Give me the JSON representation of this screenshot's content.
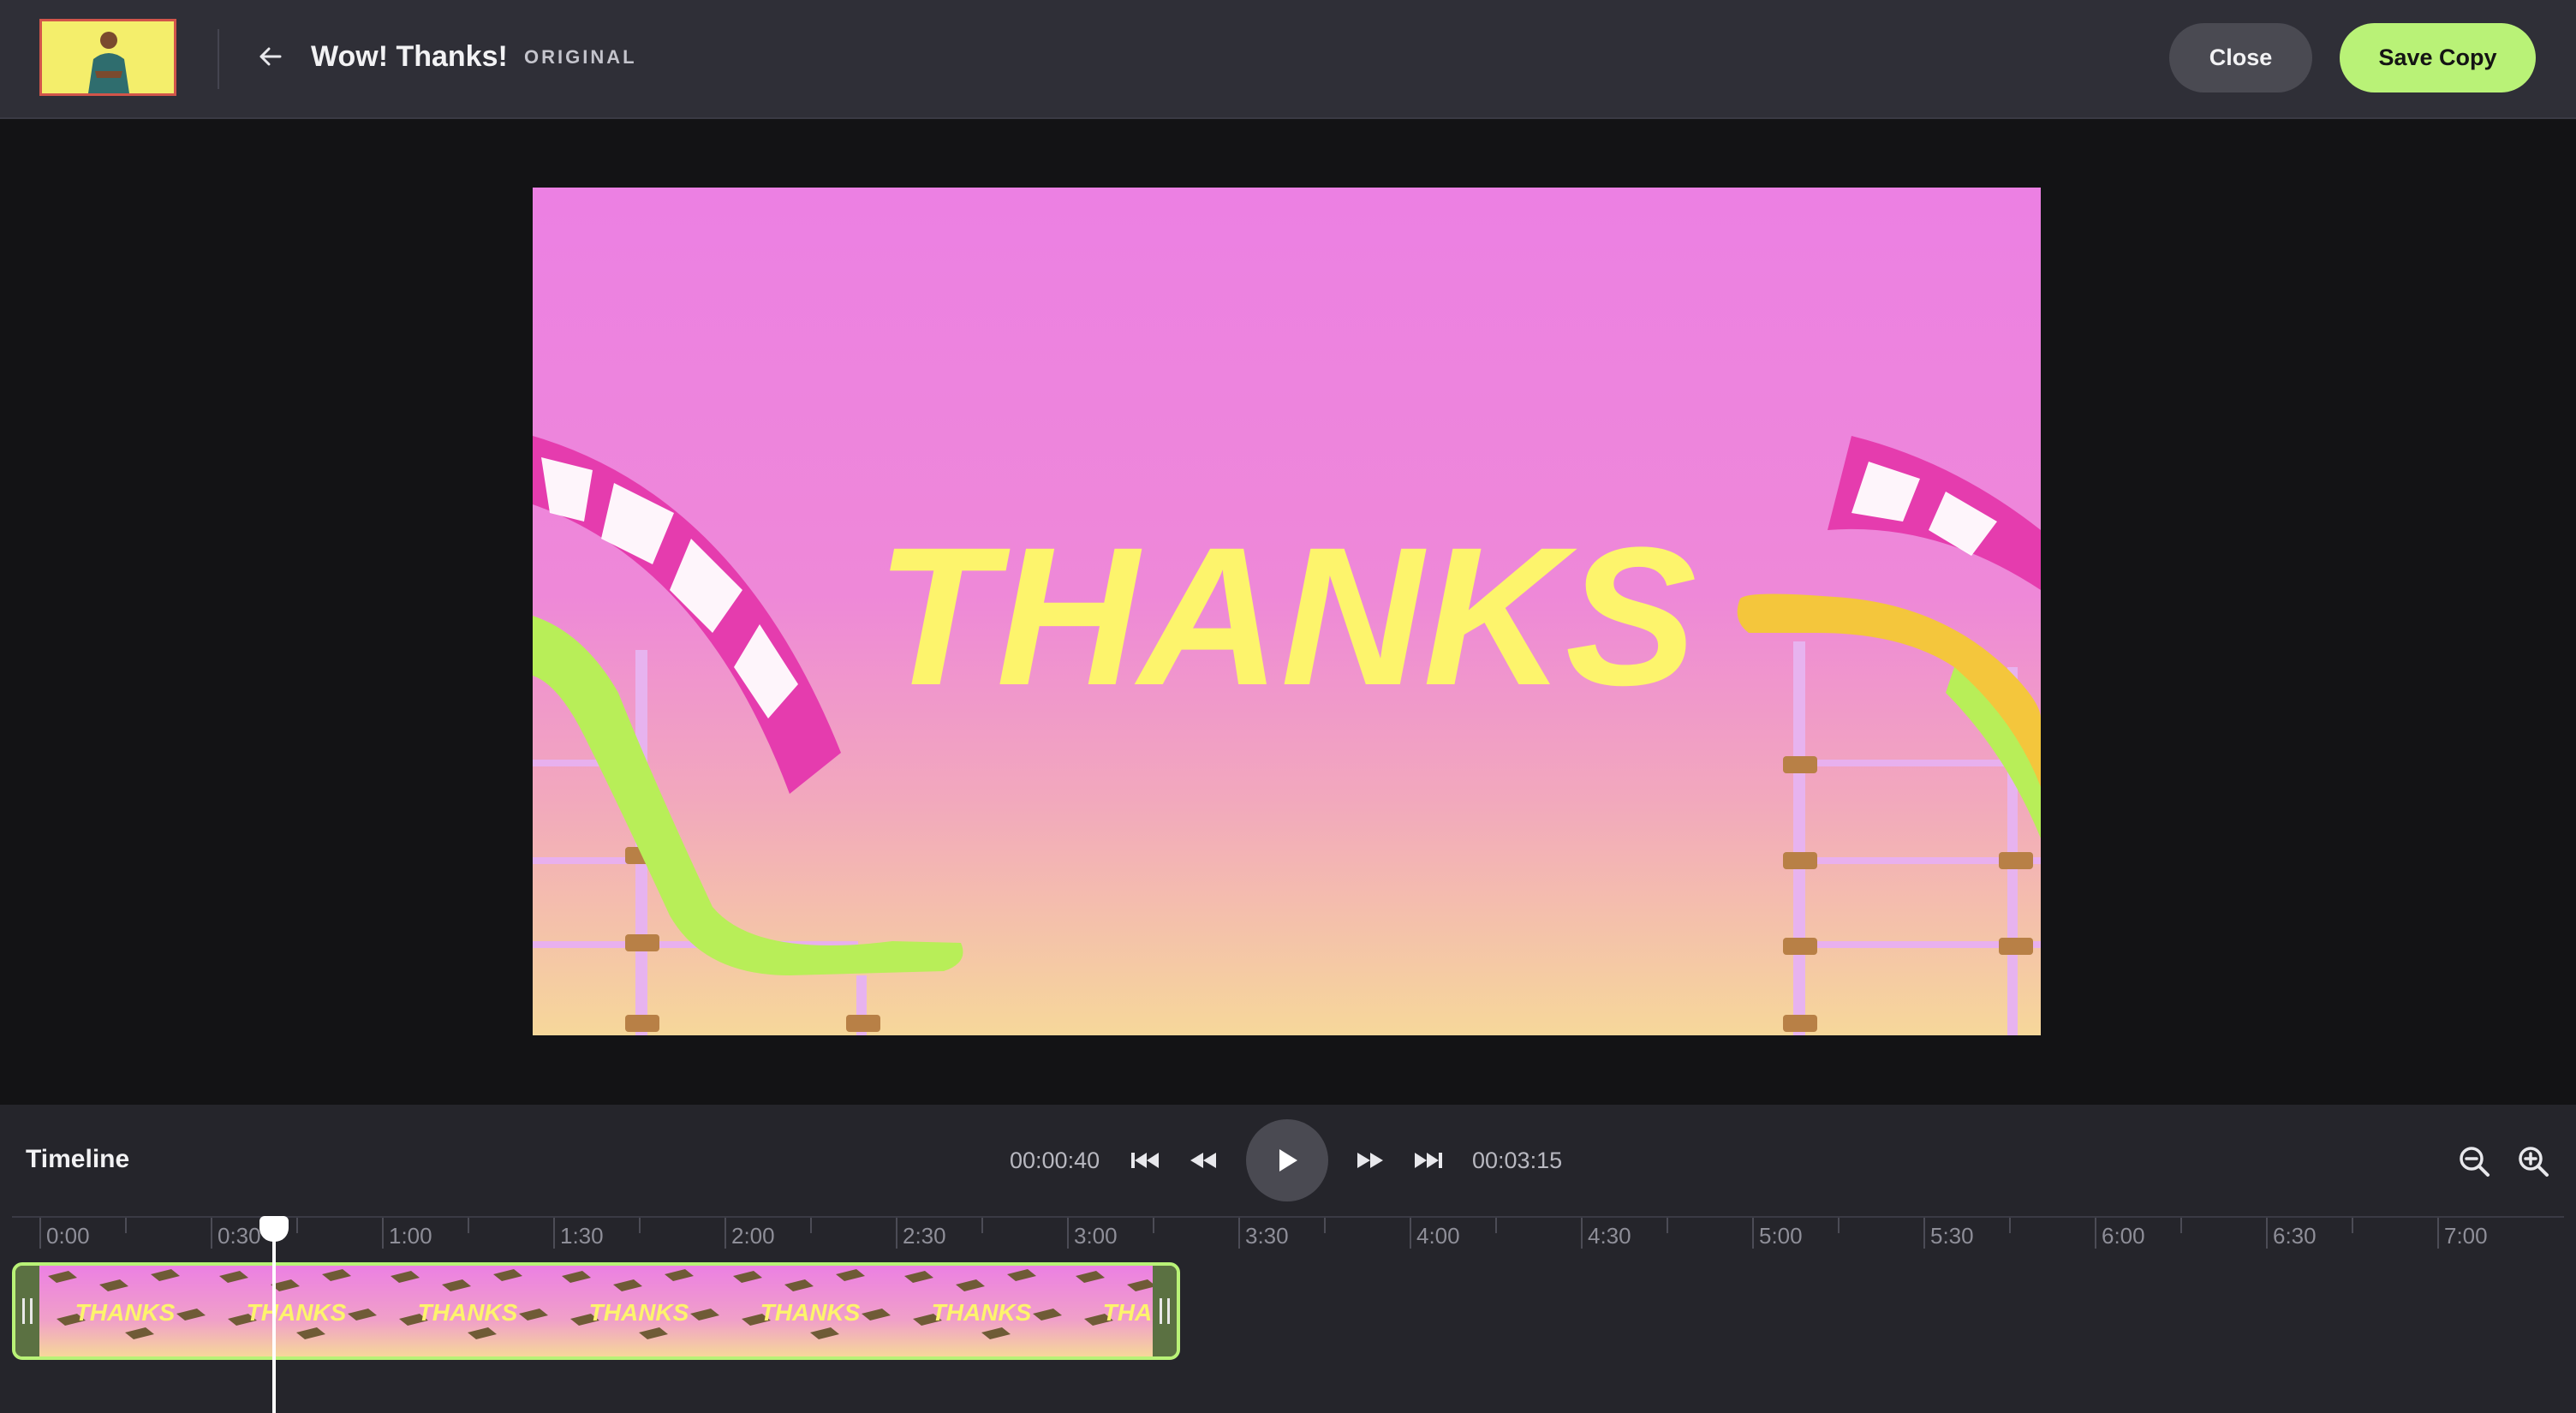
{
  "header": {
    "title": "Wow! Thanks!",
    "badge": "ORIGINAL",
    "close_label": "Close",
    "save_label": "Save Copy"
  },
  "preview": {
    "overlay_text": "THANKS"
  },
  "timeline": {
    "label": "Timeline",
    "current_time": "00:00:40",
    "total_time": "00:03:15",
    "ruler_labels": [
      "0:00",
      "0:30",
      "1:00",
      "1:30",
      "2:00",
      "2:30",
      "3:00",
      "3:30",
      "4:00",
      "4:30",
      "5:00",
      "5:30",
      "6:00",
      "6:30",
      "7:00"
    ],
    "clip_frame_text": "THANKS",
    "playhead_position_seconds": 40
  },
  "colors": {
    "accent": "#b9f277",
    "header_bg": "#2f2f37",
    "panel_bg": "#25252b",
    "preview_pink": "#ec80e3",
    "preview_peach": "#f6d79a",
    "title_yellow": "#fdf46c"
  },
  "icons": {
    "back": "arrow-left-icon",
    "skip_start": "skip-to-start-icon",
    "rewind": "rewind-icon",
    "play": "play-icon",
    "fast_forward": "fast-forward-icon",
    "skip_end": "skip-to-end-icon",
    "zoom_out": "zoom-out-icon",
    "zoom_in": "zoom-in-icon"
  }
}
